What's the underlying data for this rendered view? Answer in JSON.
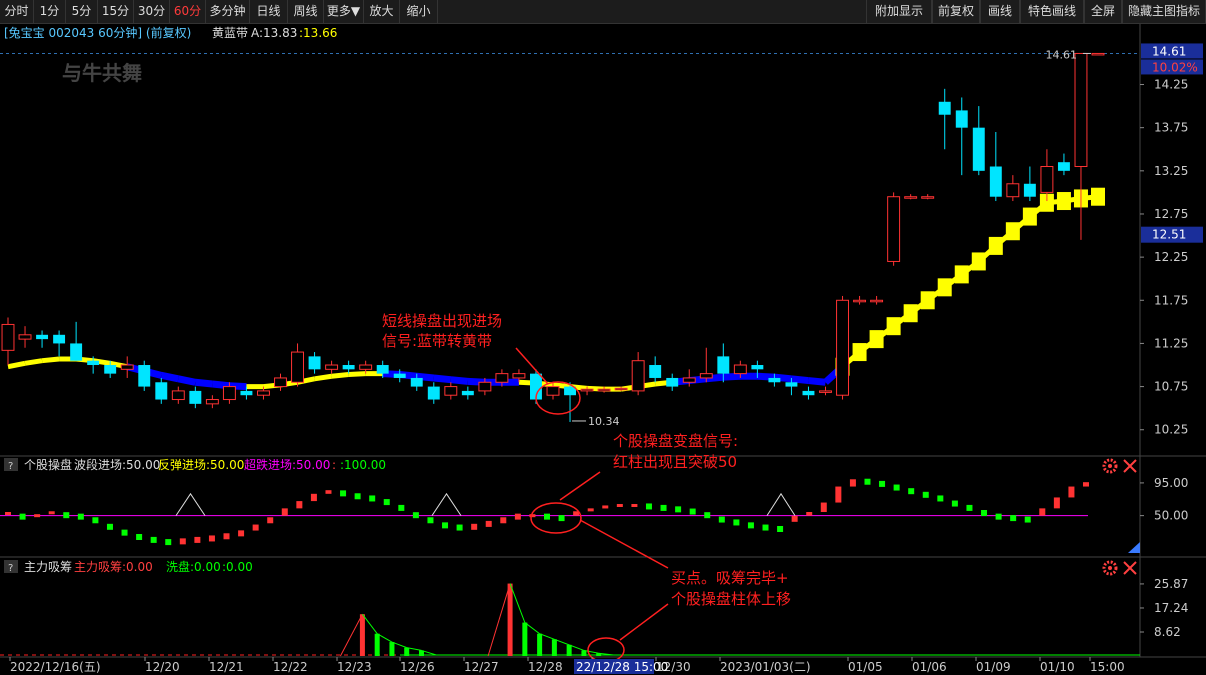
{
  "toolbar": {
    "left": [
      "分时",
      "1分",
      "5分",
      "15分",
      "30分",
      "60分",
      "多分钟",
      "日线",
      "周线",
      "更多▼",
      "放大",
      "缩小"
    ],
    "active": "60分",
    "right": [
      "附加显示",
      "前复权",
      "画线",
      "特色画线",
      "全屏",
      "隐藏主图指标"
    ]
  },
  "main_header": {
    "stock": "[兔宝宝 002043 60分钟] (前复权)",
    "indicator": "黄蓝带",
    "a_label": "A:13.83",
    "b_label": ":13.66"
  },
  "watermark": "与牛共舞",
  "price_axis": {
    "ticks": [
      "14.25",
      "13.75",
      "13.25",
      "12.75",
      "12.25",
      "11.75",
      "11.25",
      "10.75",
      "10.25"
    ],
    "top_price": "14.61",
    "top_pct": "10.02%",
    "current": "12.51"
  },
  "markers": {
    "high": "14.61",
    "low": "10.34"
  },
  "annotations": {
    "a1_line1": "短线操盘出现进场",
    "a1_line2": "信号:蓝带转黄带",
    "a2_line1": "个股操盘变盘信号:",
    "a2_line2": "红柱出现且突破50",
    "a3_line1": "买点。吸筹完毕+",
    "a3_line2": "个股操盘柱体上移"
  },
  "panel2": {
    "q": "?",
    "name": "个股操盘",
    "l1": "波段进场:50.00",
    "l2": "反弹进场:50.00",
    "l3": "超跌进场:50.00",
    "l4": ":",
    "l5": ":100.00",
    "ticks": [
      "95.00",
      "50.00"
    ]
  },
  "panel3": {
    "q": "?",
    "name": "主力吸筹",
    "l1": "主力吸筹:0.00",
    "l2": "洗盘:0.00",
    "l3": ":0.00",
    "ticks": [
      "25.87",
      "17.24",
      "8.62"
    ]
  },
  "time_axis": {
    "labels": [
      "2022/12/16(五)",
      "12/20",
      "12/21",
      "12/22",
      "12/23",
      "12/26",
      "12/27",
      "12/28",
      "12/29",
      "12/30",
      "2023/01/03(二)",
      "01/05",
      "01/06",
      "01/09",
      "01/10",
      "15:00"
    ],
    "cursor": "22/12/28 15:00"
  },
  "colors": {
    "up": "#ff3333",
    "down": "#00e5ff",
    "yellow": "#ffff00",
    "blue": "#0000ff",
    "green": "#00ff00",
    "magenta": "#ff00ff",
    "annot": "#ff2020"
  },
  "chart_data": {
    "type": "candlestick",
    "period": "60分钟",
    "candles": [
      [
        11.17,
        11.47,
        11.55,
        11.0
      ],
      [
        11.3,
        11.35,
        11.45,
        11.2
      ],
      [
        11.35,
        11.3,
        11.4,
        11.2
      ],
      [
        11.35,
        11.25,
        11.4,
        11.1
      ],
      [
        11.25,
        11.05,
        11.5,
        11.05
      ],
      [
        11.05,
        11.0,
        11.1,
        10.9
      ],
      [
        11.0,
        10.9,
        11.05,
        10.85
      ],
      [
        10.95,
        11.0,
        11.1,
        10.85
      ],
      [
        11.0,
        10.75,
        11.05,
        10.7
      ],
      [
        10.8,
        10.6,
        10.85,
        10.55
      ],
      [
        10.6,
        10.7,
        10.75,
        10.55
      ],
      [
        10.7,
        10.55,
        10.75,
        10.5
      ],
      [
        10.55,
        10.6,
        10.65,
        10.5
      ],
      [
        10.6,
        10.75,
        10.8,
        10.55
      ],
      [
        10.7,
        10.65,
        10.75,
        10.6
      ],
      [
        10.65,
        10.7,
        10.75,
        10.6
      ],
      [
        10.75,
        10.85,
        10.9,
        10.7
      ],
      [
        10.8,
        11.15,
        11.25,
        10.75
      ],
      [
        11.1,
        10.95,
        11.15,
        10.9
      ],
      [
        10.95,
        11.0,
        11.05,
        10.9
      ],
      [
        11.0,
        10.95,
        11.05,
        10.9
      ],
      [
        10.95,
        11.0,
        11.05,
        10.9
      ],
      [
        11.0,
        10.9,
        11.05,
        10.85
      ],
      [
        10.9,
        10.85,
        10.95,
        10.8
      ],
      [
        10.85,
        10.75,
        10.9,
        10.7
      ],
      [
        10.75,
        10.6,
        10.8,
        10.55
      ],
      [
        10.65,
        10.75,
        10.8,
        10.6
      ],
      [
        10.7,
        10.65,
        10.75,
        10.6
      ],
      [
        10.7,
        10.8,
        10.85,
        10.65
      ],
      [
        10.8,
        10.9,
        10.95,
        10.75
      ],
      [
        10.85,
        10.9,
        10.95,
        10.8
      ],
      [
        10.9,
        10.6,
        10.95,
        10.55
      ],
      [
        10.65,
        10.75,
        10.8,
        10.6
      ],
      [
        10.75,
        10.65,
        10.8,
        10.34
      ],
      [
        10.7,
        10.72,
        10.75,
        10.65
      ],
      [
        10.7,
        10.72,
        10.75,
        10.68
      ],
      [
        10.72,
        10.73,
        10.75,
        10.7
      ],
      [
        10.7,
        11.05,
        11.15,
        10.65
      ],
      [
        11.0,
        10.85,
        11.1,
        10.8
      ],
      [
        10.85,
        10.75,
        10.9,
        10.7
      ],
      [
        10.8,
        10.85,
        10.95,
        10.75
      ],
      [
        10.85,
        10.9,
        11.2,
        10.8
      ],
      [
        11.1,
        10.9,
        11.25,
        10.8
      ],
      [
        10.9,
        11.0,
        11.05,
        10.85
      ],
      [
        11.0,
        10.95,
        11.05,
        10.85
      ],
      [
        10.85,
        10.8,
        10.9,
        10.75
      ],
      [
        10.8,
        10.75,
        10.85,
        10.65
      ],
      [
        10.7,
        10.65,
        10.75,
        10.6
      ],
      [
        10.7,
        10.7,
        10.75,
        10.65
      ],
      [
        10.65,
        11.75,
        11.8,
        10.6
      ],
      [
        11.75,
        11.75,
        11.8,
        11.7
      ],
      [
        11.75,
        11.75,
        11.8,
        11.7
      ],
      [
        12.2,
        12.95,
        13.0,
        12.15
      ],
      [
        12.95,
        12.95,
        12.98,
        12.92
      ],
      [
        12.95,
        12.95,
        12.98,
        12.92
      ],
      [
        14.05,
        13.9,
        14.2,
        13.5
      ],
      [
        13.95,
        13.75,
        14.1,
        13.2
      ],
      [
        13.75,
        13.25,
        14.0,
        13.2
      ],
      [
        13.3,
        12.95,
        13.7,
        12.9
      ],
      [
        12.95,
        13.1,
        13.2,
        12.9
      ],
      [
        13.1,
        12.95,
        13.3,
        12.9
      ],
      [
        13.0,
        13.3,
        13.5,
        12.9
      ],
      [
        13.35,
        13.25,
        13.45,
        13.2
      ],
      [
        13.3,
        14.61,
        14.61,
        12.45
      ],
      [
        14.61,
        14.61,
        14.61,
        14.61
      ]
    ],
    "yellow_blue_band": {
      "values": [
        10.98,
        11.02,
        11.05,
        11.07,
        11.07,
        11.05,
        11.02,
        10.98,
        10.93,
        10.88,
        10.84,
        10.8,
        10.78,
        10.76,
        10.75,
        10.75,
        10.77,
        10.8,
        10.84,
        10.87,
        10.89,
        10.9,
        10.9,
        10.89,
        10.87,
        10.85,
        10.83,
        10.81,
        10.8,
        10.8,
        10.8,
        10.79,
        10.77,
        10.75,
        10.73,
        10.72,
        10.72,
        10.75,
        10.78,
        10.8,
        10.82,
        10.84,
        10.86,
        10.87,
        10.87,
        10.86,
        10.84,
        10.82,
        10.8,
        10.98,
        11.15,
        11.3,
        11.45,
        11.6,
        11.75,
        11.9,
        12.05,
        12.2,
        12.38,
        12.55,
        12.72,
        12.88,
        12.9,
        12.93,
        12.95,
        13.0,
        13.05,
        13.15,
        13.27,
        13.43,
        13.6,
        13.76
      ],
      "blue_ranges": [
        [
          7,
          13
        ],
        [
          22,
          29
        ],
        [
          39,
          48
        ]
      ]
    },
    "ylim": [
      10.05,
      14.65
    ],
    "stock_operation": {
      "ylim": [
        0,
        110
      ],
      "values": [
        55,
        50,
        52,
        56,
        52,
        50,
        45,
        36,
        28,
        22,
        18,
        15,
        16,
        18,
        20,
        23,
        27,
        35,
        45,
        60,
        70,
        80,
        85,
        82,
        78,
        75,
        70,
        62,
        52,
        45,
        38,
        35,
        36,
        40,
        45,
        50,
        52,
        50,
        48,
        56,
        60,
        64,
        66,
        66,
        64,
        62,
        60,
        57,
        52,
        46,
        42,
        38,
        35,
        33,
        47,
        55,
        68,
        90,
        100,
        98,
        95,
        90,
        85,
        80,
        75,
        68,
        62,
        55,
        50,
        48,
        46,
        60,
        75,
        90,
        96
      ]
    },
    "main_accumulation": {
      "ylim": [
        0,
        28
      ],
      "values": [
        0,
        0,
        0,
        0,
        0,
        0,
        0,
        0,
        0,
        0,
        0,
        0,
        0,
        0,
        0,
        0,
        0,
        0,
        0,
        0,
        0,
        0,
        0,
        0,
        15,
        8,
        5,
        3,
        2,
        0,
        0,
        0,
        0,
        0,
        26,
        12,
        8,
        6,
        4,
        2,
        1,
        0,
        0,
        0,
        0,
        0,
        0,
        0,
        0,
        0,
        0,
        0,
        0,
        0,
        0,
        0,
        0,
        0,
        0,
        0,
        0,
        0,
        0,
        0,
        0,
        0,
        0,
        0,
        0,
        0,
        0,
        0,
        0,
        0
      ]
    }
  }
}
